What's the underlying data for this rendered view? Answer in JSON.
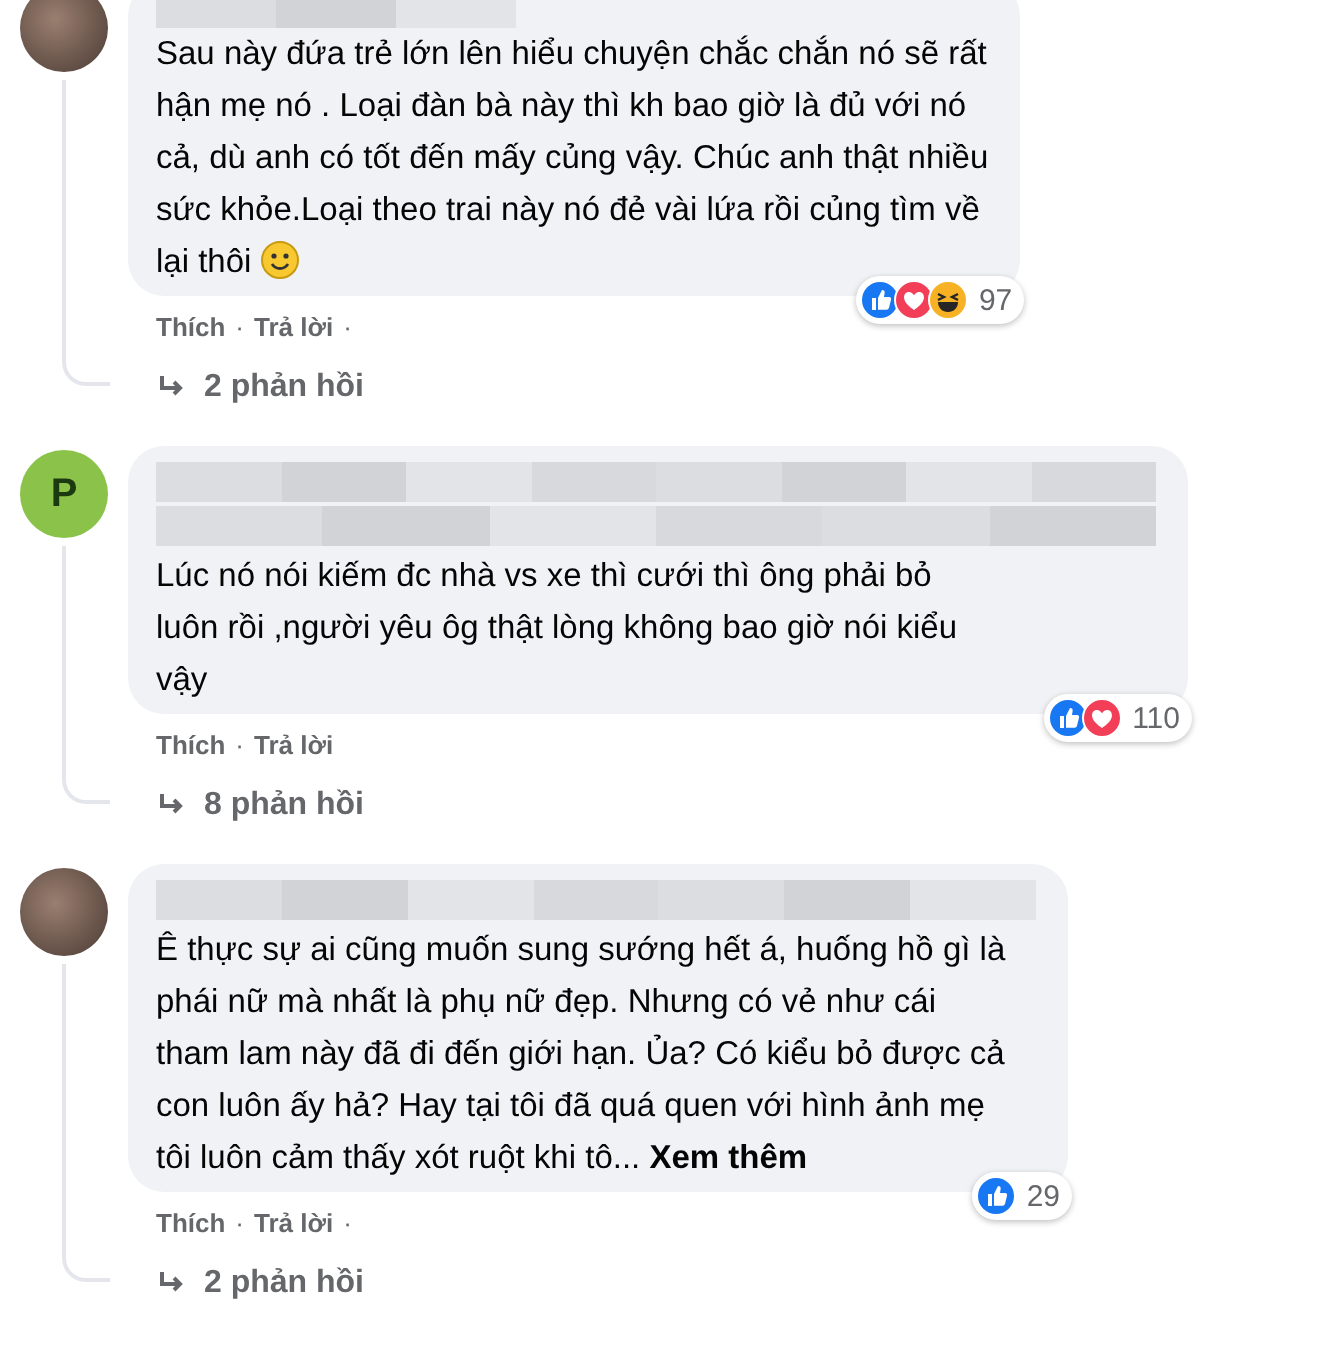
{
  "comments": [
    {
      "avatar": {
        "kind": "photo"
      },
      "name_redaction": {
        "kind": "cut"
      },
      "text": "Sau này đứa trẻ lớn lên hiểu chuyện chắc chắn nó sẽ rất\nhận mẹ nó . Loại đàn bà này thì kh bao giờ là đủ với nó\ncả, dù anh có tốt đến mấy củng vậy. Chúc anh thật nhiều\nsức khỏe.Loại theo trai này nó đẻ vài lứa rồi củng tìm về\nlại thôi",
      "emoji": {
        "kind": "smile"
      },
      "reactions": [
        {
          "kind": "like"
        },
        {
          "kind": "love"
        },
        {
          "kind": "haha"
        }
      ],
      "reaction_count": "97",
      "actions": [
        "Thích",
        "Trả lời"
      ],
      "separator": "·",
      "trailing_dot": "·",
      "replies": "2 phản hồi"
    },
    {
      "avatar": {
        "kind": "letter",
        "letter": "P",
        "color": "#8bc34a"
      },
      "name_redaction": {
        "kind": "two-line"
      },
      "text": "Lúc nó nói kiếm đc nhà vs xe thì cưới thì ông phải bỏ\nluôn rồi ,người yêu ôg thật lòng không bao giờ nói kiểu\nvậy",
      "reactions": [
        {
          "kind": "like"
        },
        {
          "kind": "love"
        }
      ],
      "reaction_count": "110",
      "actions": [
        "Thích",
        "Trả lời"
      ],
      "separator": "·",
      "replies": "8 phản hồi"
    },
    {
      "avatar": {
        "kind": "photo"
      },
      "name_redaction": {
        "kind": "one-line"
      },
      "text": "Ê thực sự ai cũng muốn sung sướng hết á, huống hồ gì là\nphái nữ mà nhất là phụ nữ đẹp. Nhưng có vẻ như cái\ntham lam này đã đi đến giới hạn. Ủa? Có kiểu bỏ được cả\ncon luôn ấy hả? Hay tại tôi đã quá quen với hình ảnh mẹ\ntôi luôn cảm thấy xót ruột khi tô...",
      "see_more": "Xem thêm",
      "reactions": [
        {
          "kind": "like"
        }
      ],
      "reaction_count": "29",
      "actions": [
        "Thích",
        "Trả lời"
      ],
      "separator": "·",
      "trailing_dot": "·",
      "replies": "2 phản hồi"
    }
  ]
}
